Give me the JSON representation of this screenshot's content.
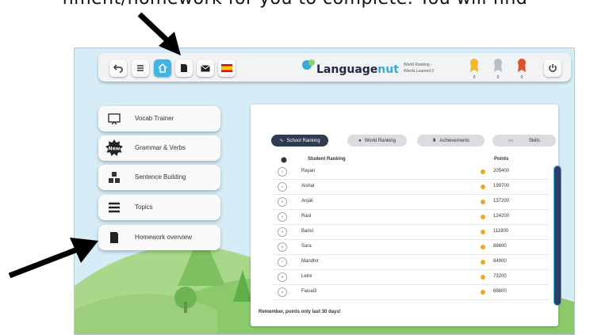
{
  "caption": "nment/homework for you to complete. You will find",
  "topbar": {
    "buttons": [
      "back-icon",
      "menu-icon",
      "home-icon",
      "homework-icon",
      "mail-icon",
      "spain-flag-icon"
    ],
    "logo_text_a": "Language",
    "logo_text_b": "nut",
    "ranking_line1": "World Ranking -",
    "ranking_line2": "Words Learned 0",
    "medals": [
      {
        "color": "#f3b82a",
        "count": "0"
      },
      {
        "color": "#b8bec5",
        "count": "0"
      },
      {
        "color": "#e0502a",
        "count": "0"
      }
    ]
  },
  "menu": {
    "vocab": "Vocab Trainer",
    "grammar": "Grammar & Verbs",
    "grammar_badge": "New",
    "sentence": "Sentence Building",
    "topics": "Topics",
    "homework": "Homework overview"
  },
  "ranking": {
    "tabs": {
      "school": "School Ranking",
      "world": "World Ranking",
      "achievements": "Achievements",
      "skills": "Skills"
    },
    "header_student": "Student Ranking",
    "header_points": "Points",
    "rows": [
      {
        "rank": "1",
        "name": "Rayan",
        "points": "205400"
      },
      {
        "rank": "2",
        "name": "Aishal",
        "points": "199700"
      },
      {
        "rank": "3",
        "name": "Anjali",
        "points": "137200"
      },
      {
        "rank": "4",
        "name": "Raul",
        "points": "124200"
      },
      {
        "rank": "5",
        "name": "Bansi",
        "points": "111900"
      },
      {
        "rank": "6",
        "name": "Sara",
        "points": "88600"
      },
      {
        "rank": "7",
        "name": "Mandhir",
        "points": "84900"
      },
      {
        "rank": "8",
        "name": "Leire",
        "points": "73200"
      },
      {
        "rank": "9",
        "name": "Faisal3",
        "points": "68600"
      }
    ],
    "footer": "Remember, points only last 30 days!"
  },
  "colors": {
    "accent": "#39a9dc",
    "active_tab": "#2f3b4f",
    "coin": "#f2a627"
  }
}
